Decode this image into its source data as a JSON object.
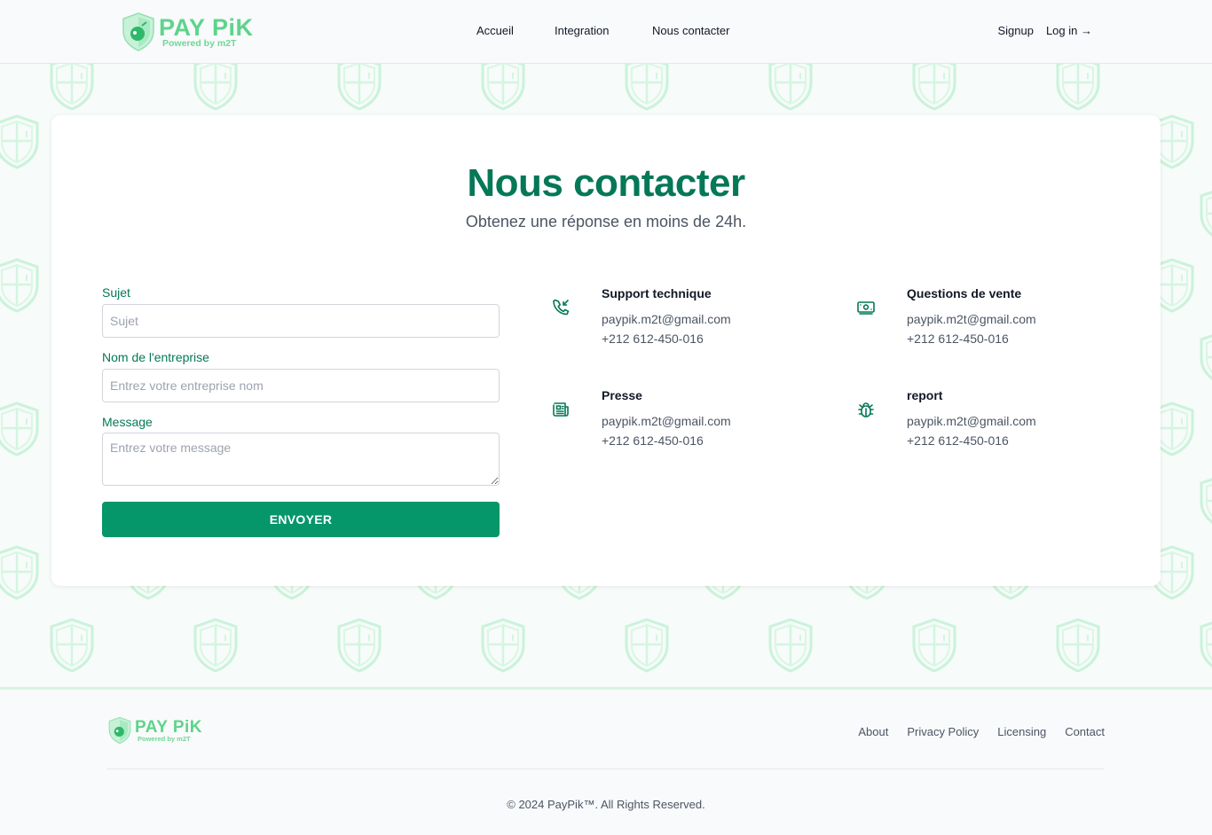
{
  "brand": {
    "name": "PAY PiK",
    "tagline": "Powered by m2T",
    "colors": {
      "primary": "#047857",
      "button": "#059669",
      "logo": "#5ed48a"
    }
  },
  "nav": {
    "items": [
      "Accueil",
      "Integration",
      "Nous contacter"
    ],
    "signup": "Signup",
    "login": "Log in →"
  },
  "page": {
    "title": "Nous contacter",
    "subtitle": "Obtenez une réponse en moins de 24h."
  },
  "form": {
    "subject_label": "Sujet",
    "subject_placeholder": "Sujet",
    "company_label": "Nom de l'entreprise",
    "company_placeholder": "Entrez votre entreprise nom",
    "message_label": "Message",
    "message_placeholder": "Entrez votre message",
    "submit": "ENVOYER"
  },
  "contacts": [
    {
      "title": "Support technique",
      "email": "paypik.m2t@gmail.com",
      "phone": "+212 612-450-016",
      "icon": "phone-incoming-icon"
    },
    {
      "title": "Questions de vente",
      "email": "paypik.m2t@gmail.com",
      "phone": "+212 612-450-016",
      "icon": "cash-icon"
    },
    {
      "title": "Presse",
      "email": "paypik.m2t@gmail.com",
      "phone": "+212 612-450-016",
      "icon": "newspaper-icon"
    },
    {
      "title": "report",
      "email": "paypik.m2t@gmail.com",
      "phone": "+212 612-450-016",
      "icon": "bug-icon"
    }
  ],
  "footer": {
    "links": [
      "About",
      "Privacy Policy",
      "Licensing",
      "Contact"
    ],
    "copyright": "© 2024 PayPik™. All Rights Reserved."
  }
}
